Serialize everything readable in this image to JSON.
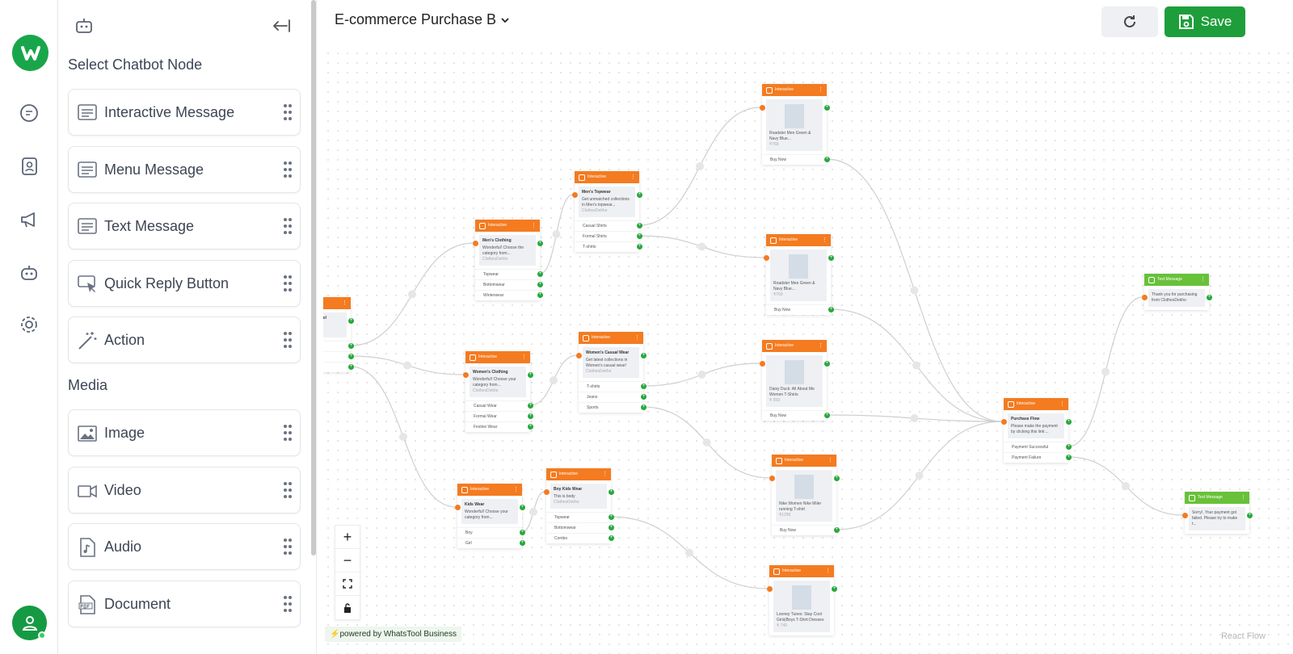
{
  "rail": {
    "icons": [
      "logo-icon",
      "chat-icon",
      "contacts-icon",
      "megaphone-icon",
      "bot-icon",
      "settings-icon",
      "user-icon"
    ]
  },
  "panel": {
    "heading": "Select Chatbot Node",
    "nodes": [
      {
        "label": "Interactive Message"
      },
      {
        "label": "Menu Message"
      },
      {
        "label": "Text Message"
      },
      {
        "label": "Quick Reply Button"
      },
      {
        "label": "Action"
      }
    ],
    "media_heading": "Media",
    "media": [
      {
        "label": "Image"
      },
      {
        "label": "Video"
      },
      {
        "label": "Audio"
      },
      {
        "label": "Document"
      }
    ]
  },
  "header": {
    "title": "E-commerce Purchase B",
    "save_label": "Save"
  },
  "canvas": {
    "powered": "⚡powered by WhatsTool Business",
    "react_flow": "React Flow",
    "nodes": [
      {
        "hd": "ive",
        "title": "to ClothesDekho!",
        "text": "lighted to serve",
        "sub": "kho",
        "opts": [
          "",
          "",
          ""
        ]
      },
      {
        "hd": "Interactive",
        "title": "Men's Clothing",
        "text": "Wonderful! Choose the category from...",
        "sub": "ClothesDekho",
        "opts": [
          "Topwear",
          "Bottomwear",
          "Winterwear"
        ]
      },
      {
        "hd": "Interactive",
        "title": "Women's Clothing",
        "text": "Wonderful! Choose your category from...",
        "sub": "ClothesDekho",
        "opts": [
          "Casual Wear",
          "Formal Wear",
          "Festive Wear"
        ]
      },
      {
        "hd": "Interactive",
        "title": "Kids Wear",
        "text": "Wonderful! Choose your category from...",
        "sub": "",
        "opts": [
          "Boy",
          "Girl"
        ]
      },
      {
        "hd": "Interactive",
        "title": "Men's Topwear",
        "text": "Get unmatched collections in Men's topwear...",
        "sub": "ClothesDekho",
        "opts": [
          "Casual Shirts",
          "Formal Shirts",
          "T-shirts"
        ]
      },
      {
        "hd": "Interactive",
        "title": "Women's Casual Wear",
        "text": "Get latest collections in Women's casual wear!",
        "sub": "ClothesDekho",
        "opts": [
          "T-shirts",
          "Jeans",
          "Sports"
        ]
      },
      {
        "hd": "Interactive",
        "title": "Boy Kids Wear",
        "text": "This is body",
        "sub": "ClothesDekho",
        "opts": [
          "Topwear",
          "Bottomwear",
          "Combo"
        ]
      },
      {
        "hd": "Interactive",
        "title": "",
        "text": "Roadster Men Green & Navy Blue...",
        "sub": "₹769",
        "opts": [
          "Buy Now"
        ],
        "img": true
      },
      {
        "hd": "Interactive",
        "title": "",
        "text": "Roadster Men Green & Navy Blue...",
        "sub": "₹769",
        "opts": [
          "Buy Now"
        ],
        "img": true
      },
      {
        "hd": "Interactive",
        "title": "",
        "text": "Daisy Duck: All About Me Women T-Shirts",
        "sub": "₹ 559",
        "opts": [
          "Buy Now"
        ],
        "img": true
      },
      {
        "hd": "Interactive",
        "title": "",
        "text": "Nike Women Nike Miler running T-shirt",
        "sub": "₹1299",
        "opts": [
          "Buy Now"
        ],
        "img": true
      },
      {
        "hd": "Interactive",
        "title": "",
        "text": "Looney Tunes: Stay Cool Girls|Boys T-Shirt Dresses",
        "sub": "₹ 749",
        "opts": [],
        "img": true
      },
      {
        "hd": "Interactive",
        "title": "Purchase Flow",
        "text": "Please make the payment by clicking this link:...",
        "sub": "",
        "opts": [
          "Payment Successful",
          "Payment Failure"
        ]
      },
      {
        "hd": "Text Message",
        "title": "",
        "text": "Thank you for purchasing from ClothesDekho",
        "sub": "",
        "opts": [],
        "green": true
      },
      {
        "hd": "Text Message",
        "title": "",
        "text": "Sorry!, Your payment got failed. Please try to make t...",
        "sub": "",
        "opts": [],
        "green": true
      }
    ]
  }
}
